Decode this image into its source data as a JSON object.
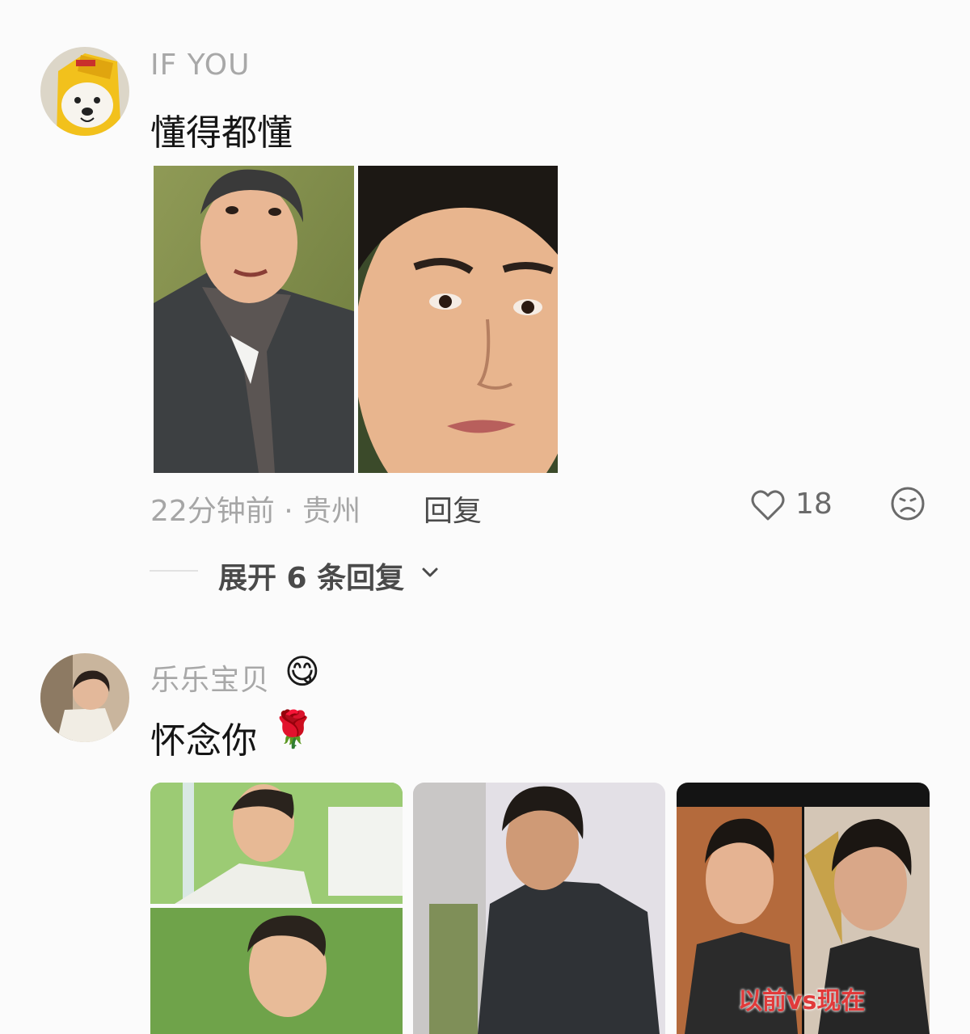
{
  "comments": [
    {
      "username": "IF YOU",
      "text": "懂得都懂",
      "time_location": "22分钟前 · 贵州",
      "reply_label": "回复",
      "likes": "18",
      "expand_label": "展开 6 条回复",
      "icons": {
        "like": "heart-outline-icon",
        "dislike": "sad-face-icon",
        "expand": "chevron-down-icon"
      }
    },
    {
      "username": "乐乐宝贝",
      "username_emoji": "😋",
      "text": "怀念你",
      "text_emoji": "🌹",
      "image_caption": "以前vs现在"
    }
  ],
  "colors": {
    "username": "#a8a8a8",
    "body_text": "#151515",
    "meta": "#a6a6a6",
    "action": "#4a4a4a"
  }
}
